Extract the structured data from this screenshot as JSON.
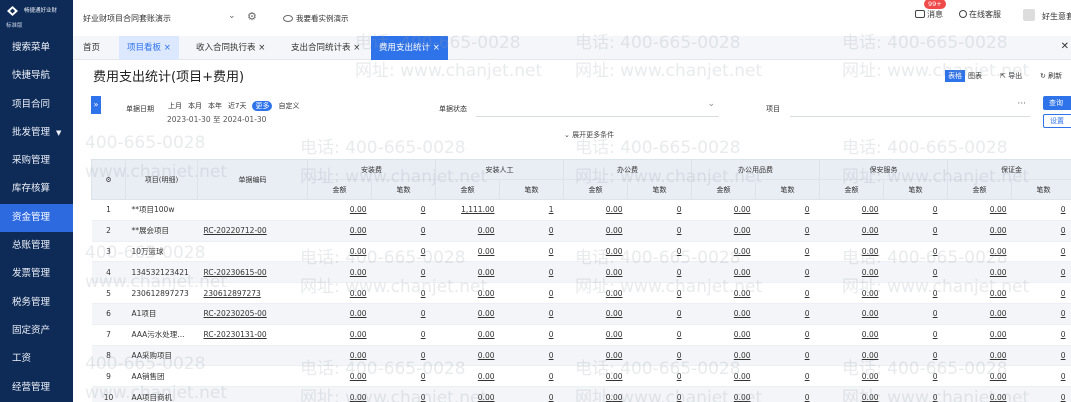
{
  "logo": {
    "name": "畅捷通好业财",
    "edition": "标准版"
  },
  "sidebar": {
    "items": [
      {
        "label": "搜索菜单",
        "active": false
      },
      {
        "label": "快捷导航",
        "active": false
      },
      {
        "label": "项目合同",
        "active": false
      },
      {
        "label": "批发管理",
        "active": false,
        "caret": "▼"
      },
      {
        "label": "采购管理",
        "active": false
      },
      {
        "label": "库存核算",
        "active": false
      },
      {
        "label": "资金管理",
        "active": true
      },
      {
        "label": "总账管理",
        "active": false
      },
      {
        "label": "发票管理",
        "active": false
      },
      {
        "label": "税务管理",
        "active": false
      },
      {
        "label": "固定资产",
        "active": false
      },
      {
        "label": "工资",
        "active": false
      },
      {
        "label": "经营管理",
        "active": false
      }
    ]
  },
  "topbar": {
    "account": "好业财项目合同套账演示",
    "tip": "我要看实例演示",
    "messages": "消息",
    "message_badge": "99+",
    "service": "在线客服",
    "user": "好生意套"
  },
  "tabs": [
    {
      "label": "首页",
      "closable": false
    },
    {
      "label": "项目看板",
      "closable": true
    },
    {
      "label": "收入合同执行表",
      "closable": true
    },
    {
      "label": "支出合同统计表",
      "closable": true
    },
    {
      "label": "费用支出统计",
      "closable": true
    }
  ],
  "page": {
    "title": "费用支出统计(项目+费用)",
    "view_table": "表格",
    "view_chart": "图表",
    "export": "导出",
    "refresh": "刷新"
  },
  "filters": {
    "date_label": "单据日期",
    "quick_options": [
      "上月",
      "本月",
      "本年",
      "近7天",
      "更多",
      "自定义"
    ],
    "quick_selected": "更多",
    "date_range": "2023-01-30 至 2024-01-30",
    "status_label": "单据状态",
    "project_label": "项目",
    "query": "查询",
    "reset": "设置",
    "more": "展开更多条件"
  },
  "table": {
    "col_project": "项目(明细)",
    "col_code": "单据编码",
    "groups": [
      "安装费",
      "安装人工",
      "办公费",
      "办公用品费",
      "保安服务",
      "保证金",
      "金"
    ],
    "sub_amount": "金额",
    "sub_count": "笔数",
    "rows": [
      {
        "idx": "1",
        "name": "**项目100w",
        "code": "",
        "vals": [
          "0.00",
          "0",
          "1,111.00",
          "1",
          "0.00",
          "0",
          "0.00",
          "0",
          "0.00",
          "0",
          "0.00",
          "0"
        ]
      },
      {
        "idx": "2",
        "name": "**展会项目",
        "code": "RC-20220712-00",
        "vals": [
          "0.00",
          "0",
          "0.00",
          "0",
          "0.00",
          "0",
          "0.00",
          "0",
          "0.00",
          "0",
          "0.00",
          "0"
        ]
      },
      {
        "idx": "3",
        "name": "10万篮球",
        "code": "",
        "vals": [
          "0.00",
          "0",
          "0.00",
          "0",
          "0.00",
          "0",
          "0.00",
          "0",
          "0.00",
          "0",
          "0.00",
          "0"
        ]
      },
      {
        "idx": "4",
        "name": "134532123421",
        "code": "RC-20230615-00",
        "vals": [
          "0.00",
          "0",
          "0.00",
          "0",
          "0.00",
          "0",
          "0.00",
          "0",
          "0.00",
          "0",
          "0.00",
          "0"
        ]
      },
      {
        "idx": "5",
        "name": "230612897273",
        "code": "230612897273",
        "vals": [
          "0.00",
          "0",
          "0.00",
          "0",
          "0.00",
          "0",
          "0.00",
          "0",
          "0.00",
          "0",
          "0.00",
          "0"
        ]
      },
      {
        "idx": "6",
        "name": "A1项目",
        "code": "RC-20230205-00",
        "vals": [
          "0.00",
          "0",
          "0.00",
          "0",
          "0.00",
          "0",
          "0.00",
          "0",
          "0.00",
          "0",
          "0.00",
          "0"
        ]
      },
      {
        "idx": "7",
        "name": "AAA污水处理...",
        "code": "RC-20230131-00",
        "vals": [
          "0.00",
          "0",
          "0.00",
          "0",
          "0.00",
          "0",
          "0.00",
          "0",
          "0.00",
          "0",
          "0.00",
          "0"
        ]
      },
      {
        "idx": "8",
        "name": "AA采购项目",
        "code": "",
        "vals": [
          "0.00",
          "0",
          "0.00",
          "0",
          "0.00",
          "0",
          "0.00",
          "0",
          "0.00",
          "0",
          "0.00",
          "0"
        ]
      },
      {
        "idx": "9",
        "name": "AA销售团",
        "code": "",
        "vals": [
          "0.00",
          "0",
          "0.00",
          "0",
          "0.00",
          "0",
          "0.00",
          "0",
          "0.00",
          "0",
          "0.00",
          "0"
        ]
      },
      {
        "idx": "10",
        "name": "AA项目商机",
        "code": "",
        "vals": [
          "0.00",
          "0",
          "0.00",
          "0",
          "0.00",
          "0",
          "0.00",
          "0",
          "0.00",
          "0",
          "0.00",
          "0"
        ]
      }
    ]
  },
  "watermark": {
    "phone": "400-665-0028",
    "phone_cn": "电话: 400-665-0028",
    "site": "www.chanjet.net",
    "site_cn": "网址: www.chanjet.net"
  },
  "colors": {
    "sidebar": "#0e2a56",
    "accent": "#2f73ea",
    "header": "#e9eef5"
  }
}
